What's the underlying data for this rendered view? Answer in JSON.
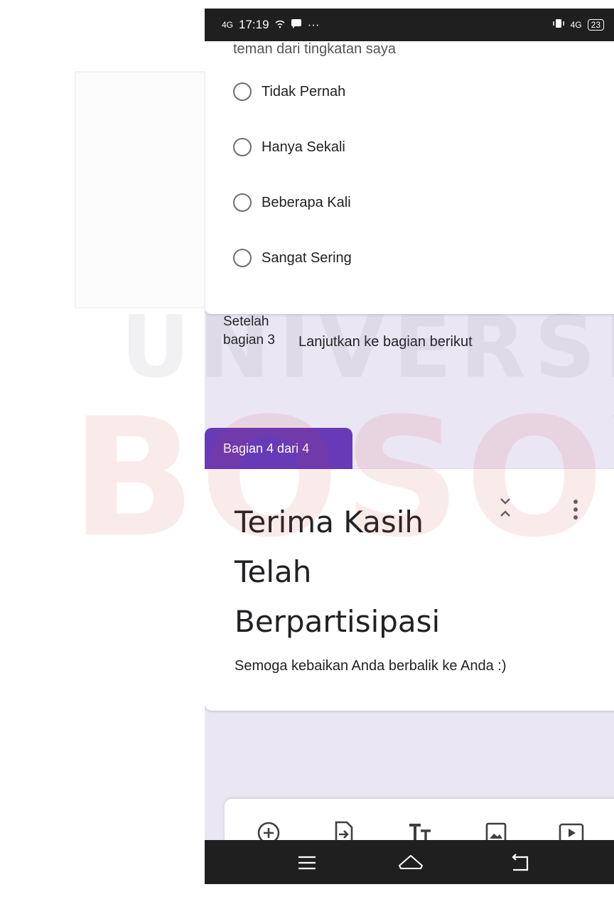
{
  "status_bar": {
    "network": "4G",
    "time": "17:19",
    "more": "···",
    "right_network": "4G",
    "battery": "23"
  },
  "question": {
    "cut_text": "teman dari tingkatan saya",
    "options": [
      {
        "label": "Tidak Pernah"
      },
      {
        "label": "Hanya Sekali"
      },
      {
        "label": "Beberapa Kali"
      },
      {
        "label": "Sangat Sering"
      }
    ]
  },
  "after_section": {
    "label": "Setelah bagian 3",
    "action": "Lanjutkan ke bagian berikut"
  },
  "section": {
    "tab_label": "Bagian 4 dari 4",
    "title": "Terima Kasih Telah Berpartisipasi",
    "description": "Semoga kebaikan Anda berbalik ke Anda :)"
  },
  "toolbar": {
    "icons": [
      "add-question-icon",
      "import-questions-icon",
      "title-text-icon",
      "image-icon",
      "video-icon"
    ]
  },
  "nav_bar": {
    "icons": [
      "menu-icon",
      "home-icon",
      "back-icon"
    ]
  },
  "watermark": {
    "line1": "UNIVERSITAS",
    "line2": "BOSOWA"
  },
  "colors": {
    "accent": "#673ab7",
    "background": "#ebe6f3",
    "status_bar": "#1f1f1f"
  }
}
